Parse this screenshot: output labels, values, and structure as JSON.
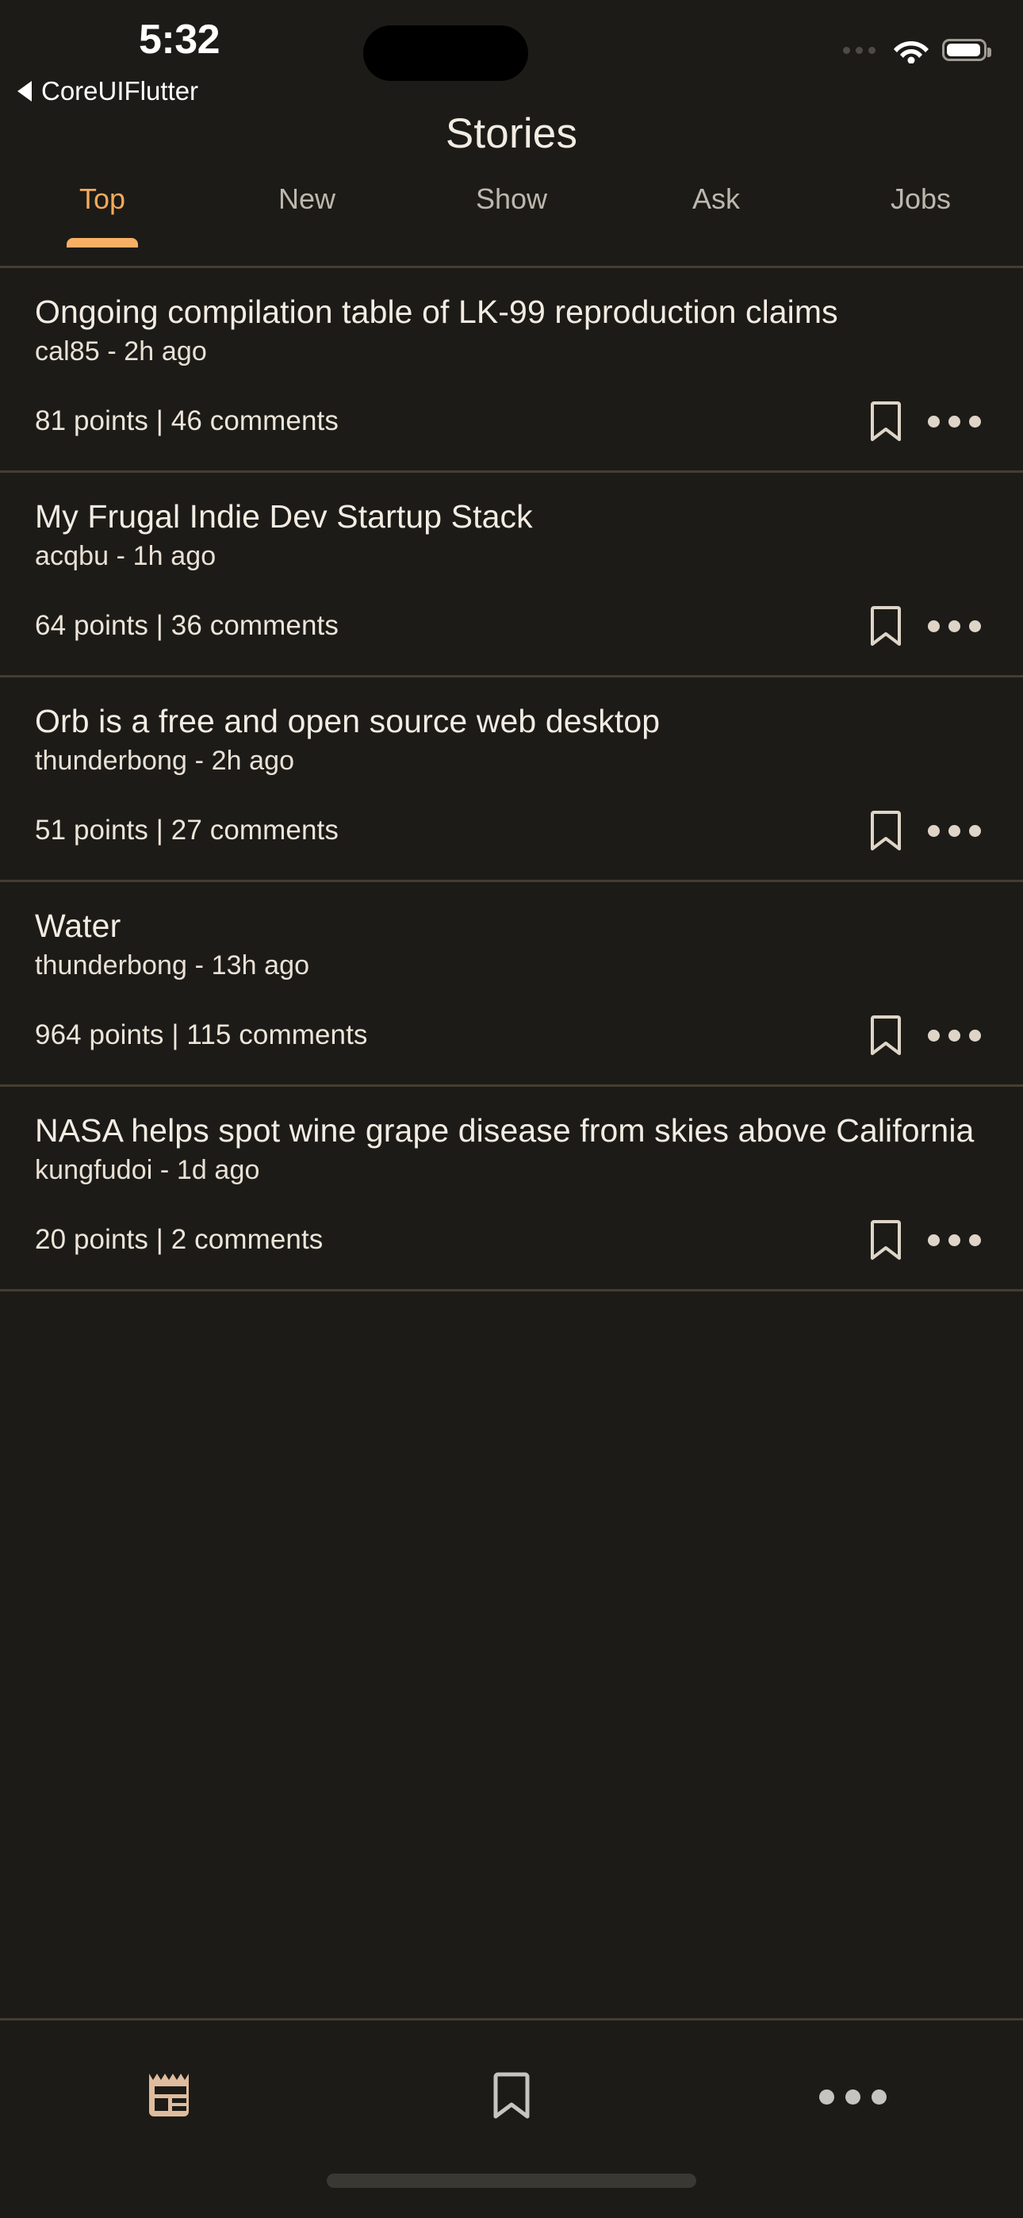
{
  "statusbar": {
    "time": "5:32",
    "wifi_icon": "wifi-icon",
    "battery_icon": "battery-icon",
    "signal_icon": "signal-dots-icon"
  },
  "back": {
    "caret_icon": "back-caret-icon",
    "label": "CoreUIFlutter"
  },
  "header": {
    "title": "Stories"
  },
  "tabs": {
    "active_index": 0,
    "active_color": "#f5a95c",
    "inactive_color": "#bdb7ae",
    "items": [
      {
        "label": "Top"
      },
      {
        "label": "New"
      },
      {
        "label": "Show"
      },
      {
        "label": "Ask"
      },
      {
        "label": "Jobs"
      }
    ]
  },
  "stories": [
    {
      "title": "Ongoing compilation table of LK-99 reproduction claims",
      "meta": "cal85 - 2h ago",
      "author": "cal85",
      "age": "2h ago",
      "points": 81,
      "comments": 46,
      "stats": "81 points | 46 comments",
      "bookmark_icon": "bookmark-icon",
      "more_icon": "more-horizontal-icon"
    },
    {
      "title": "My Frugal Indie Dev Startup Stack",
      "meta": "acqbu - 1h ago",
      "author": "acqbu",
      "age": "1h ago",
      "points": 64,
      "comments": 36,
      "stats": "64 points | 36 comments",
      "bookmark_icon": "bookmark-icon",
      "more_icon": "more-horizontal-icon"
    },
    {
      "title": "Orb is a free and open source web desktop",
      "meta": "thunderbong - 2h ago",
      "author": "thunderbong",
      "age": "2h ago",
      "points": 51,
      "comments": 27,
      "stats": "51 points | 27 comments",
      "bookmark_icon": "bookmark-icon",
      "more_icon": "more-horizontal-icon"
    },
    {
      "title": "Water",
      "meta": "thunderbong - 13h ago",
      "author": "thunderbong",
      "age": "13h ago",
      "points": 964,
      "comments": 115,
      "stats": "964 points | 115 comments",
      "bookmark_icon": "bookmark-icon",
      "more_icon": "more-horizontal-icon"
    },
    {
      "title": "NASA helps spot wine grape disease from skies above California",
      "meta": "kungfudoi - 1d ago",
      "author": "kungfudoi",
      "age": "1d ago",
      "points": 20,
      "comments": 2,
      "stats": "20 points | 2 comments",
      "bookmark_icon": "bookmark-icon",
      "more_icon": "more-horizontal-icon"
    }
  ],
  "bottombar": {
    "active_index": 0,
    "active_color": "#dfbc9d",
    "inactive_color": "#c6c4c0",
    "items": [
      {
        "icon": "news-article-icon",
        "active": true
      },
      {
        "icon": "bookmark-icon",
        "active": false
      },
      {
        "icon": "more-horizontal-icon",
        "active": false
      }
    ]
  },
  "home_indicator": "home-indicator"
}
